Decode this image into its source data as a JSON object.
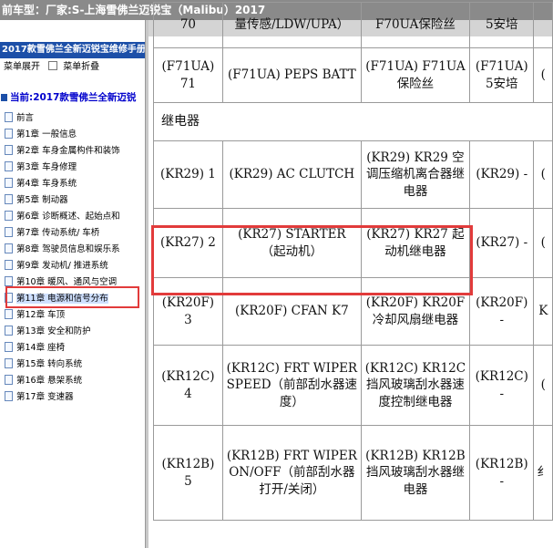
{
  "titlebar": {
    "text": "前车型：厂家:S-上海雪佛兰迈锐宝（Malibu）2017"
  },
  "sidebar": {
    "book_title": "2017款雪佛兰全新迈锐宝维修手册",
    "toolbar": {
      "expand_label": "菜单展开",
      "collapse_label": "菜单折叠"
    },
    "current_label": "当前:2017款雪佛兰全新迈锐",
    "items": [
      "前言",
      "第1章 一般信息",
      "第2章 车身金属构件和装饰",
      "第3章 车身修理",
      "第4章 车身系统",
      "第5章 制动器",
      "第6章 诊断概述、起始点和",
      "第7章 传动系统/ 车桥",
      "第8章 驾驶员信息和娱乐系",
      "第9章 发动机/ 推进系统",
      "第10章 暖风、通风与空调",
      "第11章 电源和信号分布",
      "第12章 车顶",
      "第13章 安全和防护",
      "第14章 座椅",
      "第15章 转向系统",
      "第16章 悬架系统",
      "第17章 变速器"
    ],
    "selected_index": 11
  },
  "table": {
    "rows": [
      {
        "c1": "70",
        "c2": "量传感/LDW/UPA）",
        "c3": "F70UA保险丝",
        "c4": "5安培",
        "c5": ""
      },
      {
        "c1": "(F71UA) 71",
        "c2": "(F71UA) PEPS BATT",
        "c3": "(F71UA) F71UA保险丝",
        "c4": "(F71UA) 5安培",
        "c5": "("
      },
      {
        "section": "继电器"
      },
      {
        "c1": "(KR29) 1",
        "c2": "(KR29) AC CLUTCH",
        "c3": "(KR29) KR29 空调压缩机离合器继电器",
        "c4": "(KR29) -",
        "c5": "("
      },
      {
        "c1": "(KR27) 2",
        "c2": "(KR27) STARTER（起动机）",
        "c3": "(KR27) KR27 起动机继电器",
        "c4": "(KR27) -",
        "c5": "("
      },
      {
        "c1": "(KR20F) 3",
        "c2": "(KR20F) CFAN K7",
        "c3": "(KR20F) KR20F冷却风扇继电器",
        "c4": "(KR20F) -",
        "c5": "K"
      },
      {
        "c1": "(KR12C) 4",
        "c2": "(KR12C) FRT WIPER SPEED（前部刮水器速度）",
        "c3": "(KR12C) KR12C挡风玻璃刮水器速度控制继电器",
        "c4": "(KR12C) -",
        "c5": "("
      },
      {
        "c1": "(KR12B) 5",
        "c2": "(KR12B) FRT WIPER ON/OFF（前部刮水器打开/关闭）",
        "c3": "(KR12B) KR12B挡风玻璃刮水器继电器",
        "c4": "(KR12B) -",
        "c5": "纟"
      }
    ]
  },
  "colors": {
    "highlight": "#e23b3b",
    "title_bg": "#8a8a8a",
    "book_bg": "#1c4fa8"
  }
}
